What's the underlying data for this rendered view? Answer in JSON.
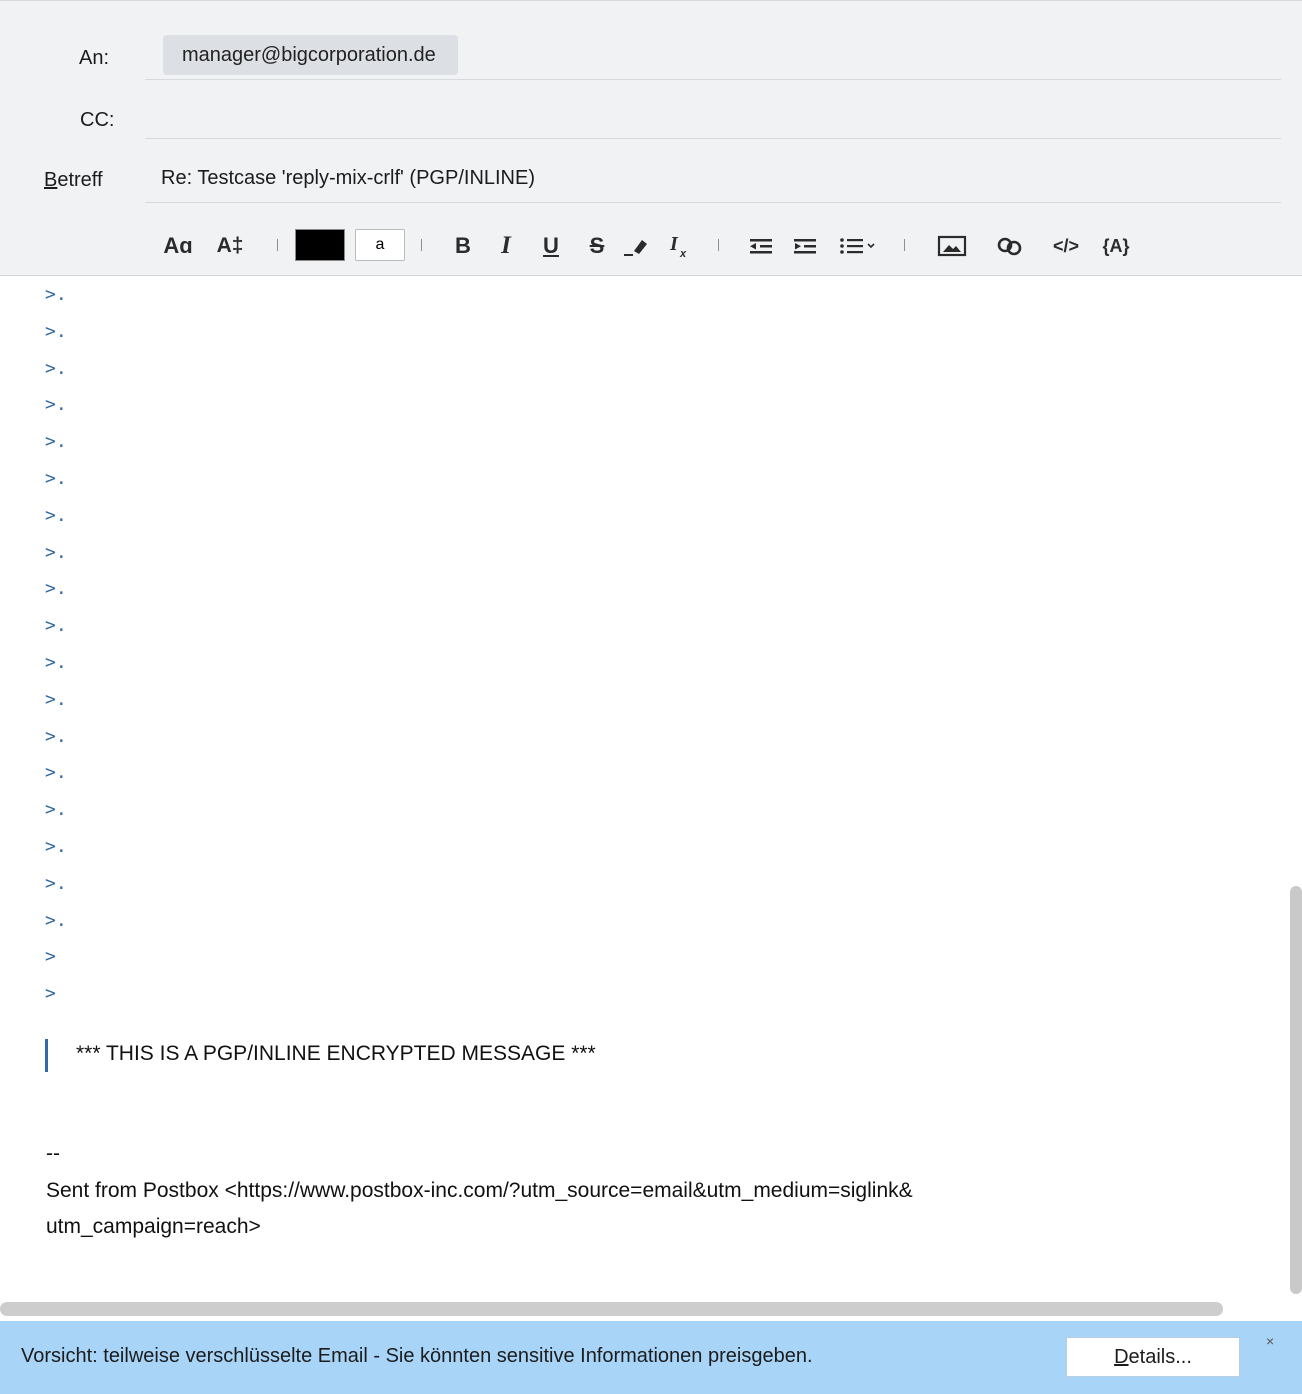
{
  "header": {
    "to_label": "An:",
    "to_value": "manager@bigcorporation.de",
    "cc_label": "CC:",
    "subject_label_accel": "B",
    "subject_label_rest": "etreff",
    "subject_value": "Re: Testcase 'reply-mix-crlf' (PGP/INLINE)"
  },
  "toolbar": {
    "font_label": "Aɑ",
    "size_label": "A‡",
    "text_color": "#000000",
    "bg_color_label": "a",
    "bold": "B",
    "italic": "I",
    "underline": "U",
    "strike": "S",
    "clear_format": "Ix",
    "code": "</>",
    "variable": "{A}"
  },
  "body": {
    "quoted_lines": [
      ">.",
      ">.",
      ">.",
      ">.",
      ">.",
      ">.",
      ">.",
      ">.",
      ">.",
      ">.",
      ">.",
      ">.",
      ">.",
      ">.",
      ">.",
      ">.",
      ">.",
      ">.",
      ">",
      ">"
    ],
    "encrypted_notice": "*** THIS IS A PGP/INLINE ENCRYPTED MESSAGE ***",
    "sig_separator": "--",
    "signature_line1": "Sent from Postbox <https://www.postbox-inc.com/?utm_source=email&utm_medium=siglink&",
    "signature_line2": "utm_campaign=reach>"
  },
  "notification": {
    "message": "Vorsicht: teilweise verschlüsselte Email - Sie könnten sensitive Informationen preisgeben.",
    "details_accel": "D",
    "details_rest": "etails...",
    "close": "×"
  },
  "colors": {
    "header_bg": "#f0f2f4",
    "quote_text": "#3469a4",
    "notification_bg": "#a8d4f8"
  }
}
